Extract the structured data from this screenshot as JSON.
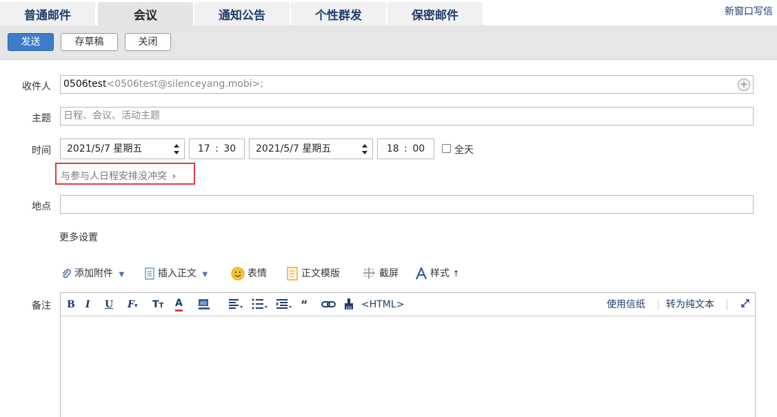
{
  "tabs": [
    {
      "label": "普通邮件",
      "active": false
    },
    {
      "label": "会议",
      "active": true
    },
    {
      "label": "通知公告",
      "active": false
    },
    {
      "label": "个性群发",
      "active": false
    },
    {
      "label": "保密邮件",
      "active": false
    }
  ],
  "header": {
    "new_window": "新窗口写信"
  },
  "toolbar": {
    "send": "发送",
    "save_draft": "存草稿",
    "close": "关闭"
  },
  "form": {
    "recipient_label": "收件人",
    "recipient_name": "0506test",
    "recipient_addr": "<0506test@silenceyang.mobi>;",
    "subject_label": "主题",
    "subject_placeholder": "日程、会议、活动主题",
    "time_label": "时间",
    "start_date": "2021/5/7 星期五",
    "start_hour": "17",
    "start_minute": "30",
    "end_date": "2021/5/7 星期五",
    "end_hour": "18",
    "end_minute": "00",
    "time_separator": ":",
    "all_day": "全天",
    "conflict_text": "与参与人日程安排没冲突",
    "location_label": "地点",
    "location_value": "",
    "more_settings": "更多设置",
    "notes_label": "备注"
  },
  "attach_bar": {
    "add_attachment": "添加附件",
    "insert_body": "插入正文",
    "emoji": "表情",
    "template": "正文模版",
    "screenshot": "截屏",
    "style": "样式"
  },
  "editor": {
    "html_label": "<HTML>",
    "use_stationery": "使用信纸",
    "plain_text": "转为纯文本"
  },
  "colors": {
    "accent": "#3d7cc9",
    "link": "#1f3c6b",
    "highlight_border": "#e23b3b"
  }
}
